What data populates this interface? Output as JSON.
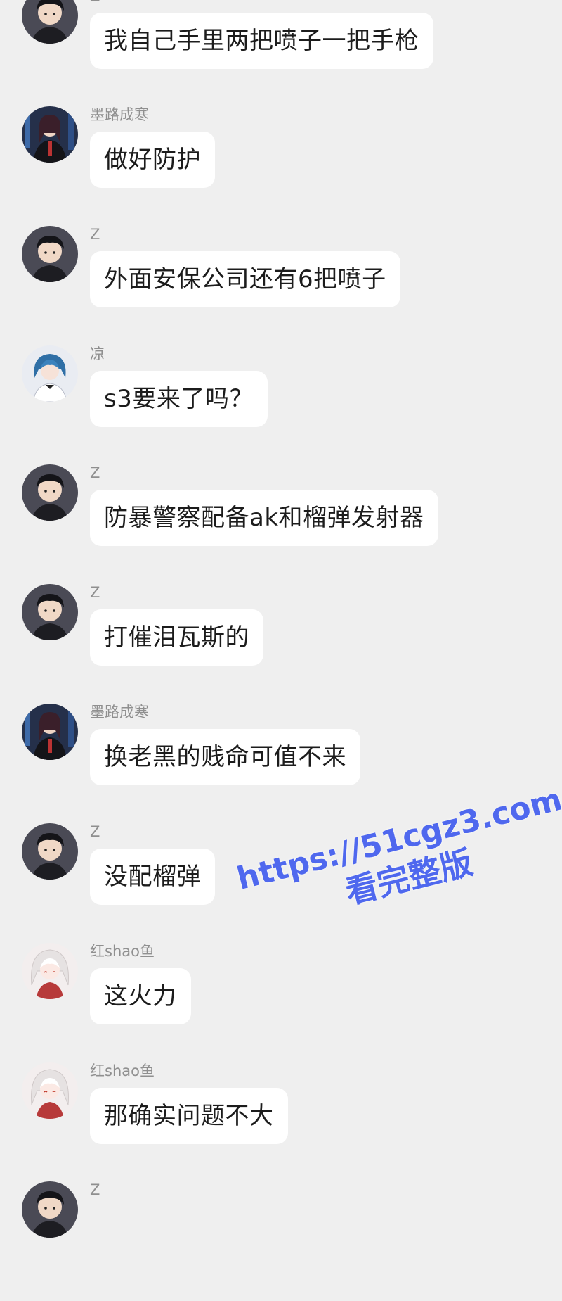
{
  "messages": [
    {
      "sender": "Z",
      "text": "我自己手里两把喷子一把手枪",
      "avatar": "boy-avatar-icon"
    },
    {
      "sender": "墨路成寒",
      "text": "做好防护",
      "avatar": "girl-dark-avatar-icon"
    },
    {
      "sender": "Z",
      "text": "外面安保公司还有6把喷子",
      "avatar": "boy-avatar-icon"
    },
    {
      "sender": "凉",
      "text": "s3要来了吗？",
      "avatar": "blue-hair-avatar-icon"
    },
    {
      "sender": "Z",
      "text": "防暴警察配备ak和榴弹发射器",
      "avatar": "boy-avatar-icon"
    },
    {
      "sender": "Z",
      "text": "打催泪瓦斯的",
      "avatar": "boy-avatar-icon"
    },
    {
      "sender": "墨路成寒",
      "text": "换老黑的贱命可值不来",
      "avatar": "girl-dark-avatar-icon"
    },
    {
      "sender": "Z",
      "text": "没配榴弹",
      "avatar": "boy-avatar-icon"
    },
    {
      "sender": "红shao鱼",
      "text": "这火力",
      "avatar": "white-hair-avatar-icon"
    },
    {
      "sender": "红shao鱼",
      "text": "那确实问题不大",
      "avatar": "white-hair-avatar-icon"
    },
    {
      "sender": "Z",
      "text": "",
      "avatar": "boy-avatar-icon"
    }
  ],
  "watermark": {
    "url": "https://51cgz3.com",
    "subtitle": "看完整版",
    "color": "#4f68ee"
  },
  "colors": {
    "background": "#efefef",
    "bubble": "#ffffff",
    "sender_name": "#8f8f8f",
    "message_text": "#1c1c1c"
  }
}
